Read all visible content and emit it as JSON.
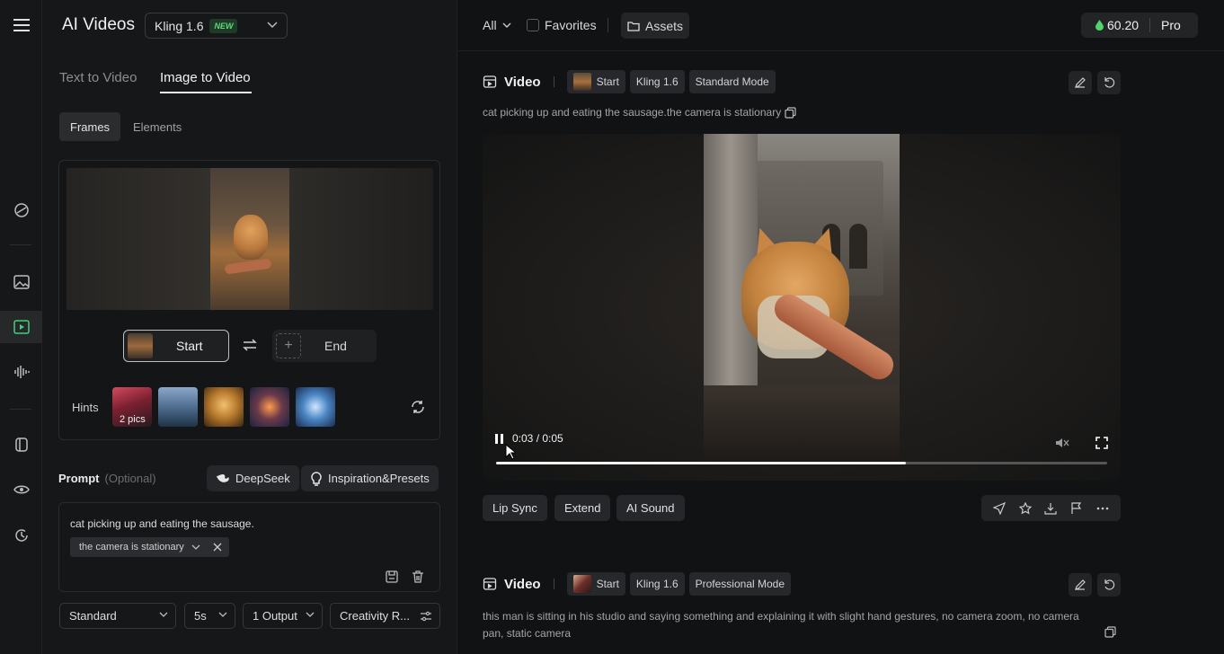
{
  "app": {
    "title": "AI Videos",
    "model": "Kling 1.6",
    "model_badge": "NEW"
  },
  "tabs": [
    {
      "label": "Text to Video",
      "active": false
    },
    {
      "label": "Image to Video",
      "active": true
    }
  ],
  "subtabs": [
    {
      "label": "Frames",
      "active": true
    },
    {
      "label": "Elements",
      "active": false
    }
  ],
  "frames": {
    "start_label": "Start",
    "end_label": "End"
  },
  "hints": {
    "label": "Hints",
    "first_caption": "2 pics"
  },
  "prompt": {
    "label": "Prompt",
    "optional": "(Optional)",
    "deepseek_label": "DeepSeek",
    "inspiration_label": "Inspiration&Presets",
    "text": "cat picking up and eating the sausage.",
    "chip": "the camera is stationary"
  },
  "settings": {
    "mode": "Standard",
    "duration": "5s",
    "outputs": "1 Output",
    "creativity": "Creativity R..."
  },
  "topbar": {
    "filter": "All",
    "favorites": "Favorites",
    "assets": "Assets",
    "credits": "60.20",
    "plan": "Pro"
  },
  "videos": [
    {
      "title": "Video",
      "tags": [
        "Start",
        "Kling 1.6",
        "Standard Mode"
      ],
      "description": "cat picking up and eating the sausage.the camera is stationary",
      "time": "0:03 / 0:05",
      "progress": 0.67,
      "actions": [
        "Lip Sync",
        "Extend",
        "AI Sound"
      ]
    },
    {
      "title": "Video",
      "tags": [
        "Start",
        "Kling 1.6",
        "Professional Mode"
      ],
      "description_line1": "this man is sitting in his studio and saying something and explaining it with slight hand gestures, no camera zoom, no camera",
      "description_line2": "pan, static camera"
    }
  ],
  "colors": {
    "accent_green": "#5fd77f",
    "active_icon": "#3fd37a"
  }
}
